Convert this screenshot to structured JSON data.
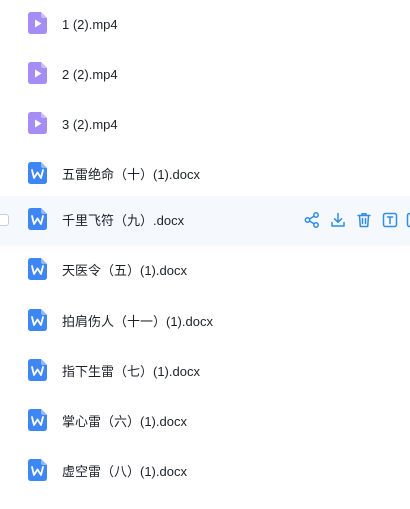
{
  "files": [
    {
      "name": "1 (2).mp4",
      "icon": "video-file-icon"
    },
    {
      "name": "2 (2).mp4",
      "icon": "video-file-icon"
    },
    {
      "name": "3 (2).mp4",
      "icon": "video-file-icon"
    },
    {
      "name": "五雷绝命（十）(1).docx",
      "icon": "word-doc-icon"
    },
    {
      "name": "千里飞符（九）.docx",
      "icon": "word-doc-icon"
    },
    {
      "name": "天医令（五）(1).docx",
      "icon": "word-doc-icon"
    },
    {
      "name": "拍肩伤人（十一）(1).docx",
      "icon": "word-doc-icon"
    },
    {
      "name": "指下生雷（七）(1).docx",
      "icon": "word-doc-icon"
    },
    {
      "name": "掌心雷（六）(1).docx",
      "icon": "word-doc-icon"
    },
    {
      "name": "虚空雷（八）(1).docx",
      "icon": "word-doc-icon"
    }
  ],
  "hovered_row_actions": [
    "share-icon",
    "download-icon",
    "delete-icon",
    "rename-icon",
    "more-icon"
  ],
  "colors": {
    "video_icon": "#a58df5",
    "word_icon": "#3f86f5",
    "action_icon": "#2f8de4",
    "hover_bg": "#f5f8fd",
    "text": "#1d2129"
  }
}
